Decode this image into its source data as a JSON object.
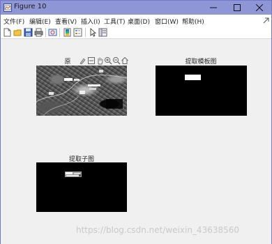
{
  "window": {
    "title": "Figure 10"
  },
  "menu": [
    {
      "label": "文件(F)"
    },
    {
      "label": "编辑(E)"
    },
    {
      "label": "查看(V)"
    },
    {
      "label": "插入(I)"
    },
    {
      "label": "工具(T)"
    },
    {
      "label": "桌面(D)"
    },
    {
      "label": "窗口(W)"
    },
    {
      "label": "帮助(H)"
    }
  ],
  "toolbar_icons": [
    "new-figure-icon",
    "open-file-icon",
    "save-icon",
    "print-icon",
    "link-plot-icon",
    "colorbar-icon",
    "legend-icon",
    "pointer-icon",
    "property-inspector-icon"
  ],
  "axes_toolbar_icons": [
    "brush-icon",
    "datatip-icon",
    "pan-icon",
    "zoom-in-icon",
    "zoom-out-icon",
    "home-icon"
  ],
  "plots": {
    "original": {
      "title": "原"
    },
    "template": {
      "title": "提取模板图"
    },
    "subimage": {
      "title": "提取子图"
    }
  },
  "watermark": "https://blog.csdn.net/weixin_43638560",
  "colors": {
    "titlebar": "#8f96d6",
    "canvas": "#f0f0f0",
    "axes": "#000000"
  }
}
